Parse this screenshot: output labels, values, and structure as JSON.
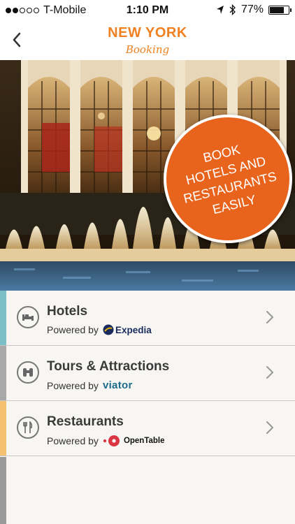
{
  "status_bar": {
    "carrier": "T-Mobile",
    "time": "1:10 PM",
    "battery": "77%",
    "battery_level": 0.77,
    "signal_bars": 2,
    "signal_total": 5
  },
  "nav": {
    "title": "NEW YORK",
    "subtitle": "Booking"
  },
  "hero": {
    "badge_lines": [
      "BOOK",
      "HOTELS AND",
      "RESTAURANTS",
      "EASILY"
    ]
  },
  "items": [
    {
      "title": "Hotels",
      "powered_by": "Powered by",
      "brand": "Expedia",
      "icon": "bed-icon",
      "accent": "#7dbfc7"
    },
    {
      "title": "Tours & Attractions",
      "powered_by": "Powered by",
      "brand": "viator",
      "icon": "binoculars-icon",
      "accent": "#a8a8a8"
    },
    {
      "title": "Restaurants",
      "powered_by": "Powered by",
      "brand": "OpenTable",
      "icon": "fork-knife-icon",
      "accent": "#f5c071"
    }
  ],
  "colors": {
    "brand_orange": "#f08020",
    "badge": "#e8641d"
  }
}
